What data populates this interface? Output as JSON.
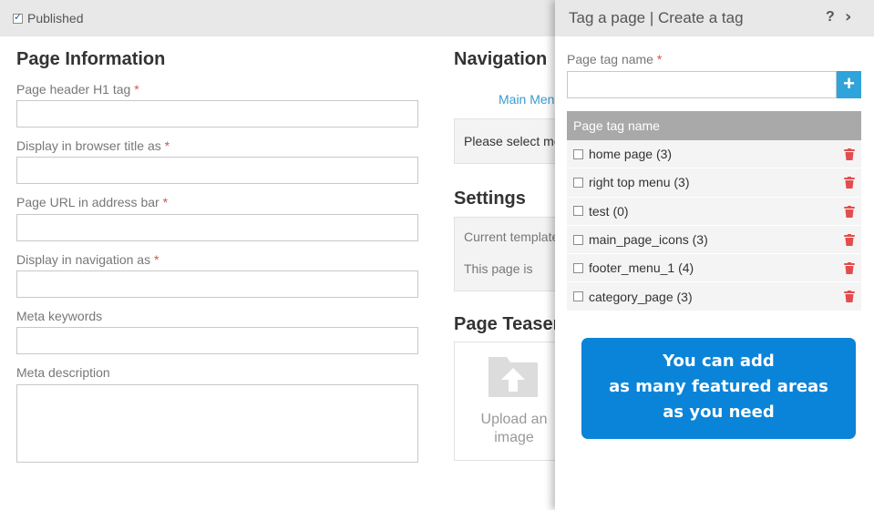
{
  "topbar": {
    "published_label": "Published",
    "published_checked": true
  },
  "page_info": {
    "title": "Page Information",
    "fields": {
      "h1": {
        "label": "Page header H1 tag",
        "required": "*",
        "value": ""
      },
      "browser_title": {
        "label": "Display in browser title as",
        "required": "*",
        "value": ""
      },
      "url": {
        "label": "Page URL in address bar",
        "required": "*",
        "value": ""
      },
      "nav": {
        "label": "Display in navigation as",
        "required": "*",
        "value": ""
      },
      "keywords": {
        "label": "Meta keywords",
        "value": ""
      },
      "description": {
        "label": "Meta description",
        "value": ""
      }
    }
  },
  "navigation": {
    "title": "Navigation",
    "link": "Main Menu",
    "hint": "Please select me"
  },
  "settings": {
    "title": "Settings",
    "template_label": "Current template",
    "page_is_label": "This page is"
  },
  "teaser": {
    "title": "Page Teaser",
    "upload_label_1": "Upload an",
    "upload_label_2": "image"
  },
  "panel": {
    "title": "Tag a page | Create a tag",
    "help": "?",
    "close": "›",
    "tag_name_label": "Page tag name",
    "tag_name_required": "*",
    "tag_name_value": "",
    "add_button": "+",
    "table_header": "Page tag name",
    "tags": [
      {
        "name": "home page (3)"
      },
      {
        "name": "right top menu (3)"
      },
      {
        "name": "test (0)"
      },
      {
        "name": "main_page_icons (3)"
      },
      {
        "name": "footer_menu_1 (4)"
      },
      {
        "name": "category_page (3)"
      }
    ],
    "callout": {
      "line1": "You can add",
      "line2": "as many featured areas",
      "line3": "as you need"
    }
  },
  "colors": {
    "accent": "#2fa3db",
    "callout_bg": "#0a84d8",
    "delete_red": "#e34d4d",
    "required": "#d9534f"
  }
}
